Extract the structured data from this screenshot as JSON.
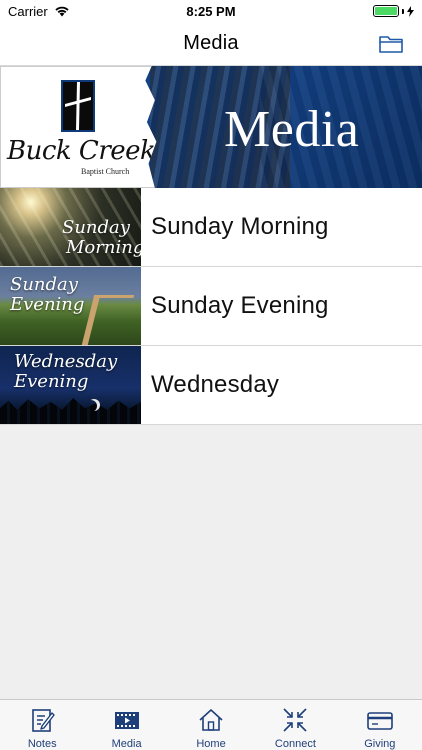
{
  "status_bar": {
    "carrier": "Carrier",
    "time": "8:25 PM",
    "battery_level": 1.0
  },
  "nav": {
    "title": "Media",
    "folder_icon": "folder-icon"
  },
  "banner": {
    "logo_name": "Buck Creek",
    "logo_sub": "Baptist Church",
    "title": "Media"
  },
  "media_items": [
    {
      "thumb_line1": "Sunday",
      "thumb_line2": "Morning",
      "label": "Sunday Morning"
    },
    {
      "thumb_line1": "Sunday",
      "thumb_line2": "Evening",
      "label": "Sunday Evening"
    },
    {
      "thumb_line1": "Wednesday",
      "thumb_line2": "Evening",
      "label": "Wednesday"
    }
  ],
  "tabs": [
    {
      "label": "Notes",
      "icon": "notes-icon",
      "selected": false
    },
    {
      "label": "Media",
      "icon": "film-icon",
      "selected": true
    },
    {
      "label": "Home",
      "icon": "home-icon",
      "selected": false
    },
    {
      "label": "Connect",
      "icon": "connect-icon",
      "selected": false
    },
    {
      "label": "Giving",
      "icon": "card-icon",
      "selected": false
    }
  ],
  "colors": {
    "accent": "#1f3f7a",
    "battery": "#4cd964",
    "banner_blue": "#15468c"
  }
}
